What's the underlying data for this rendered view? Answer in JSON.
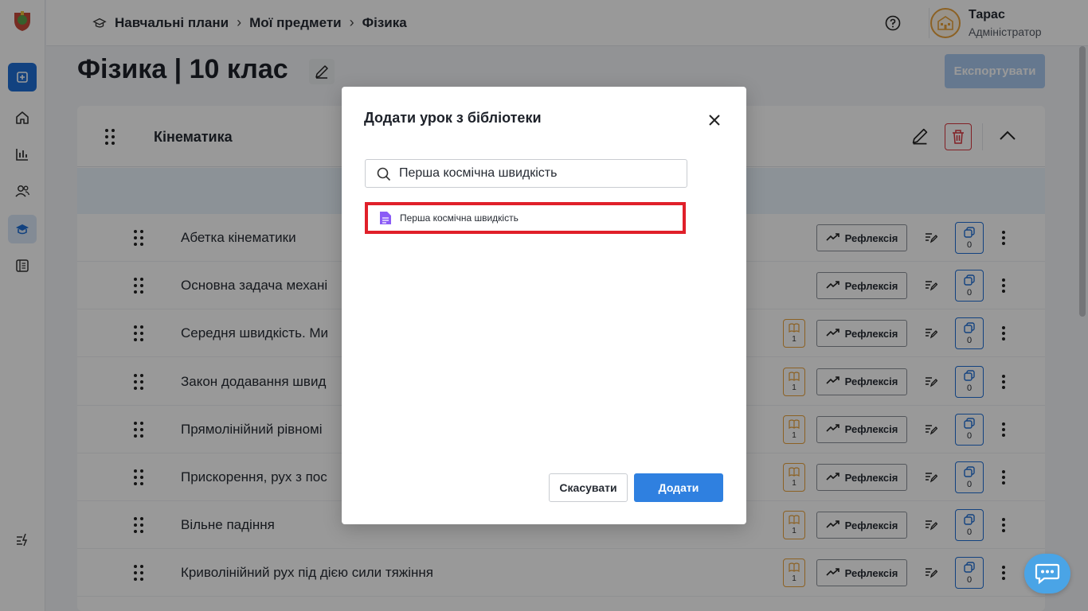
{
  "breadcrumbs": [
    "Навчальні плани",
    "Мої предмети",
    "Фізика"
  ],
  "user": {
    "name": "Тарас",
    "role": "Адміністратор"
  },
  "page": {
    "title": "Фізика | 10 клас",
    "export_label": "Експортувати"
  },
  "module": {
    "title": "Кінематика"
  },
  "lessons": [
    {
      "title": "Абетка кінематики",
      "book_count": null,
      "reflection": "Рефлексія",
      "copies": "0"
    },
    {
      "title": "Основна задача механі",
      "book_count": null,
      "reflection": "Рефлексія",
      "copies": "0"
    },
    {
      "title": "Середня швидкість. Ми",
      "book_count": "1",
      "reflection": "Рефлексія",
      "copies": "0"
    },
    {
      "title": "Закон додавання швид",
      "book_count": "1",
      "reflection": "Рефлексія",
      "copies": "0"
    },
    {
      "title": "Прямолінійний рівномі",
      "book_count": "1",
      "reflection": "Рефлексія",
      "copies": "0"
    },
    {
      "title": "Прискорення, рух з пос",
      "book_count": "1",
      "reflection": "Рефлексія",
      "copies": "0"
    },
    {
      "title": "Вільне падіння",
      "book_count": "1",
      "reflection": "Рефлексія",
      "copies": "0"
    },
    {
      "title": "Криволінійний рух під дією сили тяжіння",
      "book_count": "1",
      "reflection": "Рефлексія",
      "copies": "0"
    }
  ],
  "modal": {
    "title": "Додати урок з бібліотеки",
    "search_value": "Перша космічна швидкість",
    "result_label": "Перша космічна швидкість",
    "cancel_label": "Скасувати",
    "add_label": "Додати"
  },
  "colors": {
    "primary": "#2f80e0",
    "danger": "#d9363e",
    "accent": "#e9a23b",
    "highlight": "#e0202a",
    "doc_icon": "#8b5cf6"
  }
}
